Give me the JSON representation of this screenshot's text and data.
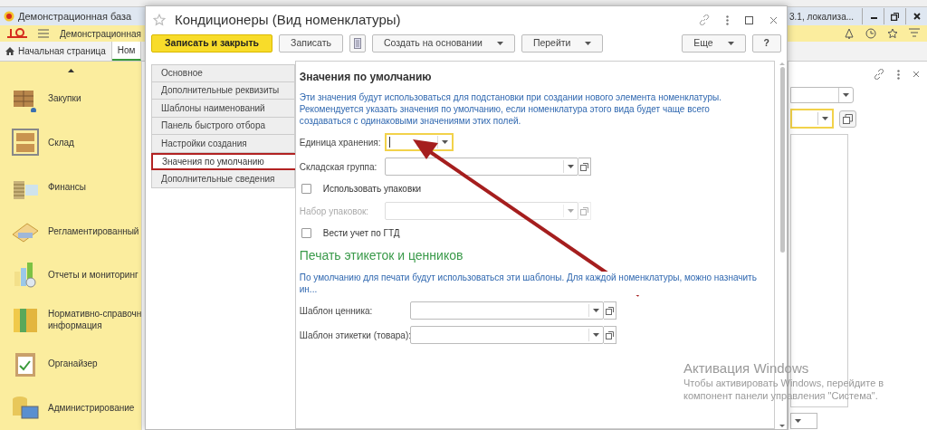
{
  "app": {
    "title_left": "Демонстрационная база",
    "title_right": "3.1, локализа...",
    "app_name": "Демонстрационная"
  },
  "app_tabs": [
    {
      "label": "Начальная страница",
      "selected": false,
      "kind": "home"
    },
    {
      "label": "Ном",
      "selected": true,
      "kind": "plain"
    }
  ],
  "sidebar": {
    "items": [
      {
        "label": "Закупки",
        "kind": "boxes"
      },
      {
        "label": "Склад",
        "kind": "shelf"
      },
      {
        "label": "Финансы",
        "kind": "coins"
      },
      {
        "label": "Регламентированный",
        "kind": "folder"
      },
      {
        "label": "Отчеты и мониторинг",
        "kind": "chart"
      },
      {
        "label": "Нормативно-справочн\nинформация",
        "kind": "binders"
      },
      {
        "label": "Органайзер",
        "kind": "clipboard"
      },
      {
        "label": "Администрирование",
        "kind": "computer"
      }
    ]
  },
  "dialog": {
    "title": "Кондиционеры (Вид номенклатуры)",
    "toolbar": [
      {
        "kind": "primary",
        "label": "Записать и закрыть"
      },
      {
        "kind": "button",
        "label": "Записать"
      },
      {
        "kind": "icon"
      },
      {
        "kind": "dropdown",
        "label": "Создать на основании"
      },
      {
        "kind": "dropdown",
        "label": "Перейти"
      },
      {
        "kind": "spacer"
      },
      {
        "kind": "dropdown",
        "label": "Еще"
      },
      {
        "kind": "button",
        "label": "?"
      }
    ],
    "nav": [
      {
        "label": "Основное",
        "selected": false
      },
      {
        "label": "Дополнительные реквизиты",
        "selected": false
      },
      {
        "label": "Шаблоны наименований",
        "selected": false
      },
      {
        "label": "Панель быстрого отбора",
        "selected": false
      },
      {
        "label": "Настройки создания",
        "selected": false
      },
      {
        "label": "Значения по умолчанию",
        "selected": true
      },
      {
        "label": "Дополнительные сведения",
        "selected": false
      }
    ],
    "content": [
      {
        "kind": "heading",
        "text": "Значения по умолчанию"
      },
      {
        "kind": "info",
        "text": "Эти значения будут использоваться для подстановки при создании нового элемента номенклатуры. Рекомендуется указать значения по умолчанию, если номенклатура этого вида будет чаще всего создаваться с одинаковыми значениями этих полей."
      },
      {
        "kind": "field",
        "label": "Единица хранения:",
        "focused": true,
        "disabled": false,
        "open_button": false,
        "wide": false
      },
      {
        "kind": "field",
        "label": "Складская группа:",
        "focused": false,
        "disabled": false,
        "open_button": true,
        "wide": false
      },
      {
        "kind": "checkbox",
        "label": "Использовать упаковки",
        "checked": false
      },
      {
        "kind": "field",
        "label": "Набор упаковок:",
        "focused": false,
        "disabled": true,
        "open_button": true,
        "wide": false
      },
      {
        "kind": "checkbox",
        "label": "Вести учет по ГТД",
        "checked": false
      },
      {
        "kind": "subheading",
        "text": "Печать этикеток и ценников"
      },
      {
        "kind": "info",
        "text": "По умолчанию для печати будут использоваться эти шаблоны. Для каждой номенклатуры, можно назначить ин..."
      },
      {
        "kind": "field",
        "label": "Шаблон ценника:",
        "focused": false,
        "disabled": false,
        "open_button": true,
        "wide": true
      },
      {
        "kind": "field",
        "label": "Шаблон этикетки (товара):",
        "focused": false,
        "disabled": false,
        "open_button": true,
        "wide": true
      }
    ]
  },
  "os_notice": {
    "title": "Активация Windows",
    "text": "Чтобы активировать Windows, перейдите в компонент панели управления \"Система\"."
  }
}
